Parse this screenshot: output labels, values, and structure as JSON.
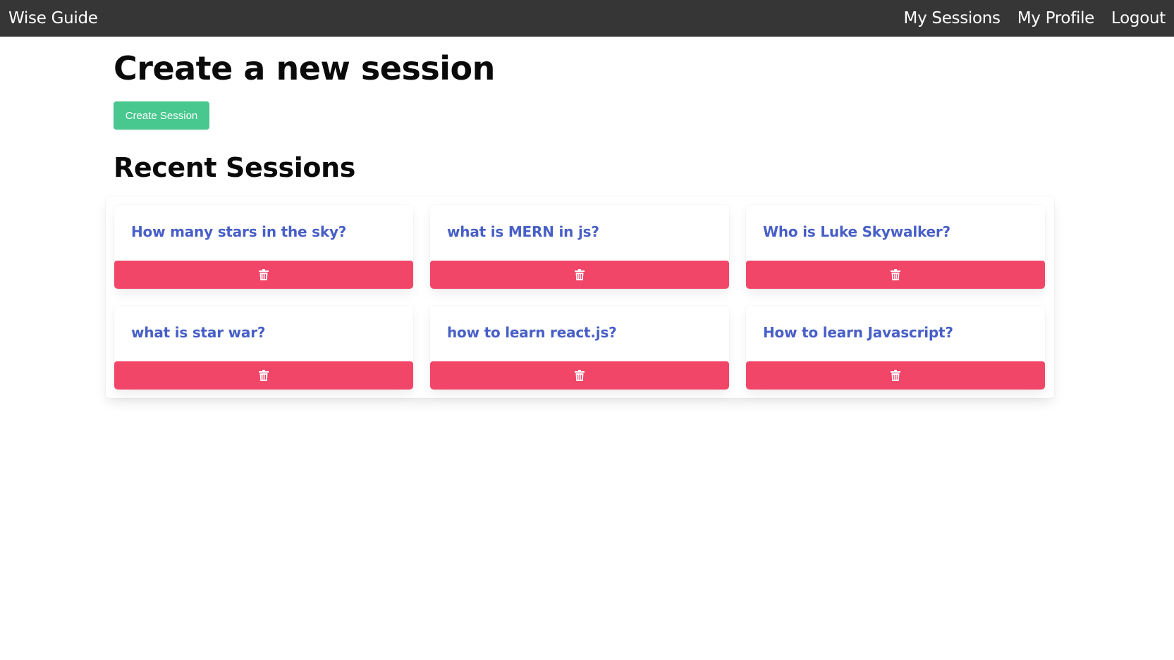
{
  "navbar": {
    "brand": "Wise Guide",
    "links": [
      {
        "label": "My Sessions"
      },
      {
        "label": "My Profile"
      },
      {
        "label": "Logout"
      }
    ]
  },
  "main": {
    "title": "Create a new session",
    "create_button_label": "Create Session",
    "recent_title": "Recent Sessions",
    "sessions": [
      {
        "title": "How many stars in the sky?",
        "delete_icon": "trash-icon"
      },
      {
        "title": "what is MERN in js?",
        "delete_icon": "trash-icon"
      },
      {
        "title": "Who is Luke Skywalker?",
        "delete_icon": "trash-icon"
      },
      {
        "title": "what is star war?",
        "delete_icon": "trash-icon"
      },
      {
        "title": "how to learn react.js?",
        "delete_icon": "trash-icon"
      },
      {
        "title": "How to learn Javascript?",
        "delete_icon": "trash-icon"
      }
    ]
  },
  "colors": {
    "navbar_bg": "#363636",
    "create_button": "#48c78e",
    "delete_button": "#f14668",
    "session_link": "#485fc7"
  }
}
